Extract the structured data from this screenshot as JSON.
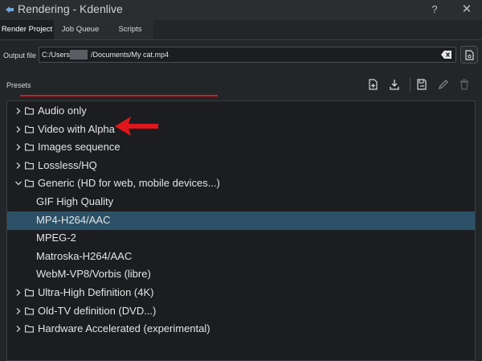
{
  "window": {
    "title": "Rendering - Kdenlive",
    "help_label": "?",
    "close_label": "✕"
  },
  "tabs": [
    {
      "label": "Render Project",
      "active": true
    },
    {
      "label": "Job Queue",
      "active": false
    },
    {
      "label": "Scripts",
      "active": false
    }
  ],
  "output": {
    "label": "Output file",
    "path_prefix": "C:/Users/",
    "path_suffix": "/Documents/My cat.mp4"
  },
  "presets": {
    "label": "Presets",
    "toolbar_icons": [
      "new-preset-icon",
      "download-preset-icon",
      "save-preset-icon",
      "edit-preset-icon",
      "delete-preset-icon"
    ]
  },
  "tree": [
    {
      "label": "Audio only",
      "type": "category",
      "expanded": false
    },
    {
      "label": "Video with Alpha",
      "type": "category",
      "expanded": false
    },
    {
      "label": "Images sequence",
      "type": "category",
      "expanded": false
    },
    {
      "label": "Lossless/HQ",
      "type": "category",
      "expanded": false
    },
    {
      "label": "Generic (HD for web, mobile devices...)",
      "type": "category",
      "expanded": true
    },
    {
      "label": "GIF High Quality",
      "type": "preset",
      "selected": false
    },
    {
      "label": "MP4-H264/AAC",
      "type": "preset",
      "selected": true
    },
    {
      "label": "MPEG-2",
      "type": "preset",
      "selected": false
    },
    {
      "label": "Matroska-H264/AAC",
      "type": "preset",
      "selected": false
    },
    {
      "label": "WebM-VP8/Vorbis (libre)",
      "type": "preset",
      "selected": false
    },
    {
      "label": "Ultra-High Definition (4K)",
      "type": "category",
      "expanded": false
    },
    {
      "label": "Old-TV definition (DVD...)",
      "type": "category",
      "expanded": false
    },
    {
      "label": "Hardware Accelerated (experimental)",
      "type": "category",
      "expanded": false
    }
  ],
  "colors": {
    "selection": "#2c5167",
    "annotation": "#e0161b"
  }
}
